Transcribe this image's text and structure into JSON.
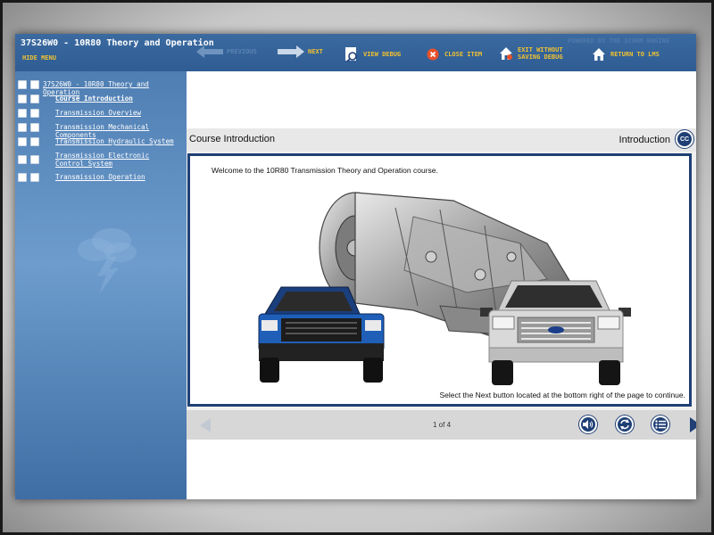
{
  "header": {
    "course_title": "37S26W0 - 10R80 Theory and Operation",
    "hide_menu": "HIDE MENU",
    "powered_by": "POWERED BY THE SCORM ENGINE"
  },
  "toolbar": {
    "previous": "PREVIOUS",
    "next": "NEXT",
    "view_debug": "VIEW DEBUG",
    "close_item": "CLOSE ITEM",
    "exit_line1": "EXIT WITHOUT",
    "exit_line2": "SAVING DEBUG",
    "return_lms": "RETURN TO LMS"
  },
  "sidebar": {
    "items": [
      {
        "label": "37S26W0 - 10R80 Theory and Operation"
      },
      {
        "label": "Course Introduction"
      },
      {
        "label": "Transmission Overview"
      },
      {
        "label": "Transmission Mechanical Components"
      },
      {
        "label": "Transmission Hydraulic System"
      },
      {
        "label": "Transmission Electronic Control System"
      },
      {
        "label": "Transmission Operation"
      }
    ]
  },
  "content_header": {
    "left": "Course Introduction",
    "right": "Introduction",
    "cc_label": "CC"
  },
  "content": {
    "welcome": "Welcome to the 10R80 Transmission Theory and Operation course.",
    "continue": "Select the Next button located at the bottom right of the page to continue."
  },
  "navbar": {
    "page": "1 of 4"
  },
  "colors": {
    "accent": "#f2c230",
    "brand_blue": "#1f3f75",
    "header_blue": "#3b6aa0"
  }
}
